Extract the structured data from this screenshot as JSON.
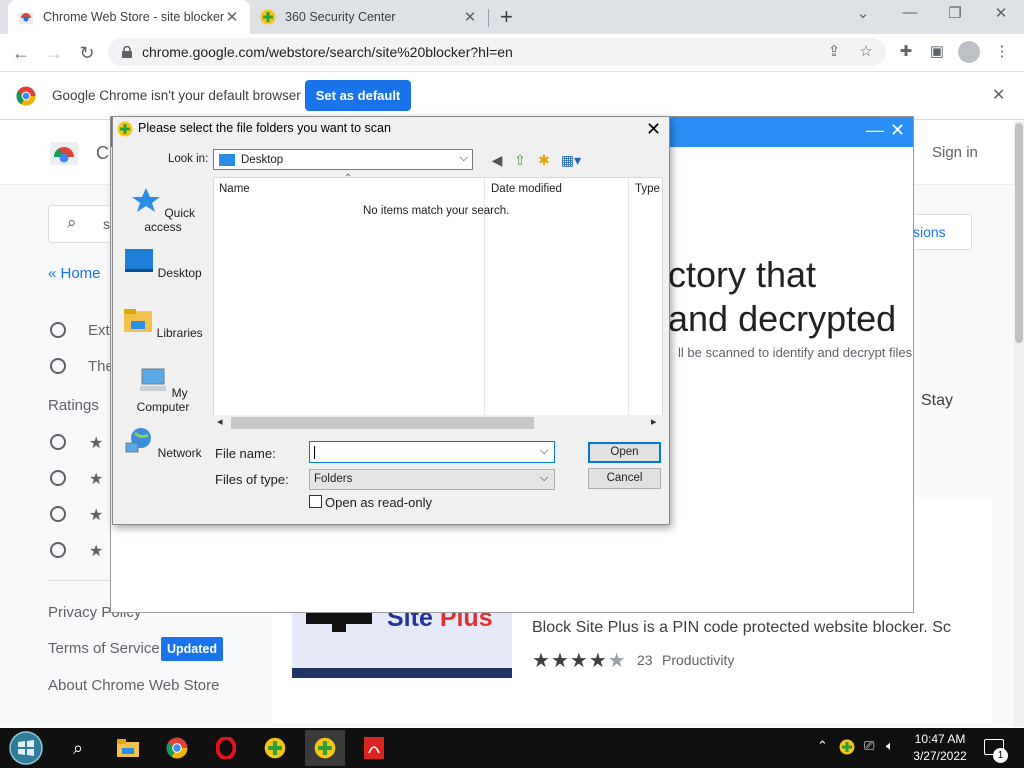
{
  "browser": {
    "tabs": [
      {
        "title": "Chrome Web Store - site blocker",
        "active": true
      },
      {
        "title": "360 Security Center",
        "active": false
      }
    ],
    "url": "chrome.google.com/webstore/search/site%20blocker?hl=en",
    "infobar": {
      "message": "Google Chrome isn't your default browser",
      "button": "Set as default"
    }
  },
  "webstore": {
    "header_title_partial": "C",
    "sign_in": "Sign in",
    "search_partial": "si",
    "home_link": "« Home",
    "filters": [
      "Exte",
      "The"
    ],
    "ratings_heading": "Ratings",
    "footer_links": [
      "Privacy Policy",
      "Terms of Service",
      "About Chrome Web Store"
    ],
    "updated_badge": "Updated",
    "permissions_partial": "sions",
    "stay_partial": "Stay",
    "result": {
      "banner_site": "Site",
      "banner_plus": "Plus",
      "description": "Block Site Plus is a PIN code protected website blocker. Sc",
      "rating": 4,
      "rating_count": "23",
      "category": "Productivity"
    }
  },
  "app360": {
    "heading_line1": "ctory that",
    "heading_line2": "and decrypted",
    "subtext": "ll be scanned to identify and decrypt files"
  },
  "dialog": {
    "title": "Please select the file folders you want to scan",
    "look_in_label": "Look in:",
    "look_in_value": "Desktop",
    "places": [
      "Quick access",
      "Desktop",
      "Libraries",
      "My Computer",
      "Network"
    ],
    "columns": [
      "Name",
      "Date modified",
      "Type"
    ],
    "empty_message": "No items match your search.",
    "file_name_label": "File name:",
    "file_name_value": "",
    "files_of_type_label": "Files of type:",
    "files_of_type_value": "Folders",
    "read_only_label": "Open as read-only",
    "open_button": "Open",
    "cancel_button": "Cancel"
  },
  "taskbar": {
    "time": "10:47 AM",
    "date": "3/27/2022",
    "notification_count": "1"
  },
  "colors": {
    "chrome_blue": "#1a73e8",
    "app360_blue": "#2a8ff4",
    "taskbar": "#101010"
  }
}
